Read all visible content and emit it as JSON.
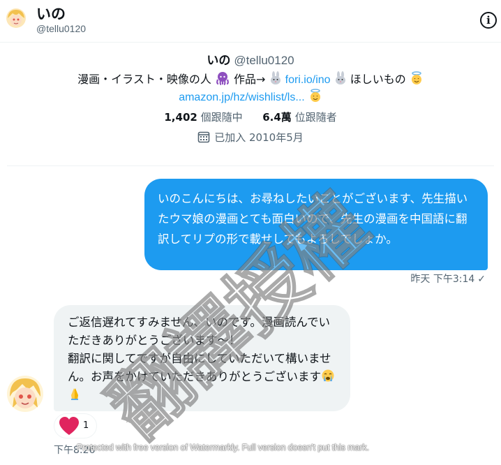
{
  "header": {
    "name": "いの",
    "handle": "@tellu0120"
  },
  "profile": {
    "name": "いの",
    "handle": "@tellu0120",
    "bio_text": "漫画・イラスト・映像の人",
    "bio_works": "作品→",
    "bio_link1": "fori.io/ino",
    "bio_wish": "ほしいもの",
    "bio_link2": "amazon.jp/hz/wishlist/ls...",
    "following_count": "1,402",
    "following_label": "個跟隨中",
    "followers_count": "6.4萬",
    "followers_label": "位跟隨者",
    "joined": "已加入 2010年5月"
  },
  "conversation": {
    "sent_message": "いのこんにちは、お尋ねしたいことがございます、先生描いたウマ娘の漫画とても面白いので、先生の漫画を中国語に翻訳してリプの形で載せしてもよろしでしょか。",
    "sent_time": "昨天 下午3:14",
    "reply_line1": "ご返信遅れてすみません、いのです。漫画読んでいただきありがとうございます～！",
    "reply_line2": "翻訳に関してですが自由にしていただいて構いません。お声をかけていただきありがとうございます",
    "reaction_count": "1",
    "reply_time": "下午8:26"
  },
  "watermark": {
    "text": "翻譯授權",
    "note": "Protected with free version of Watermarkly. Full version doesn't put this mark."
  },
  "colors": {
    "accent": "#1d9bf0",
    "bubble_received": "#eff3f4",
    "heart": "#e0245e"
  }
}
